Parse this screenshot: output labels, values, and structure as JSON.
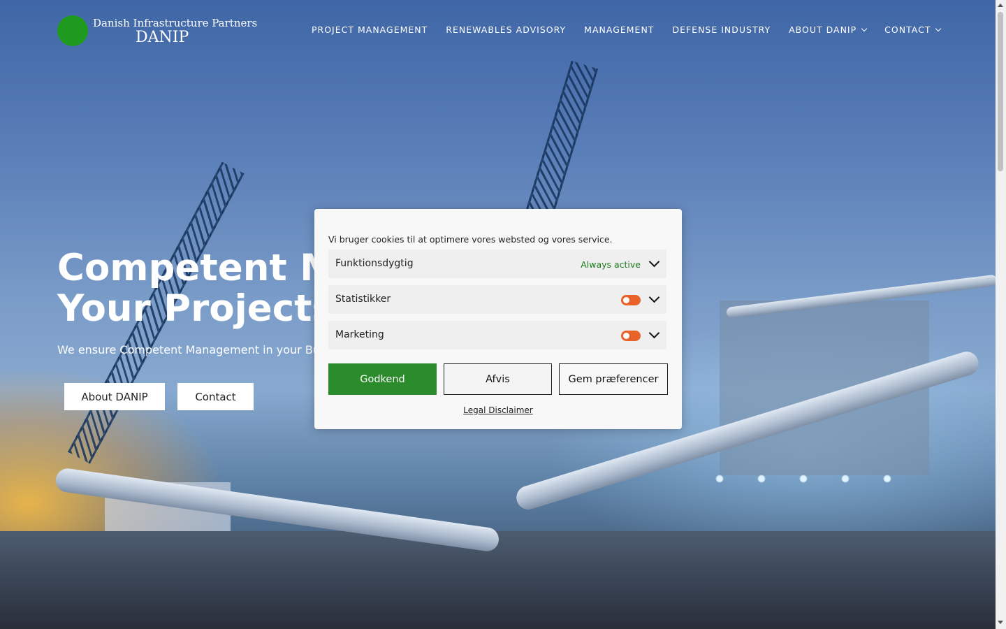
{
  "header": {
    "logo_line1": "Danish Infrastructure Partners",
    "logo_line2": "DANIP",
    "nav": [
      {
        "label": "PROJECT MANAGEMENT"
      },
      {
        "label": "RENEWABLES ADVISORY"
      },
      {
        "label": "MANAGEMENT"
      },
      {
        "label": "DEFENSE INDUSTRY"
      },
      {
        "label": "ABOUT DANIP",
        "dropdown": true
      },
      {
        "label": "CONTACT",
        "dropdown": true
      }
    ]
  },
  "hero": {
    "headline_line1": "Competent Ma",
    "headline_line2": "Your Projects",
    "tagline": "We ensure Competent Management in your Busi",
    "buttons": {
      "about": "About DANIP",
      "contact": "Contact"
    }
  },
  "cookie_banner": {
    "intro": "Vi bruger cookies til at optimere vores websted og vores service.",
    "categories": [
      {
        "label": "Funktionsdygtig",
        "status": "Always active"
      },
      {
        "label": "Statistikker",
        "toggle": "off"
      },
      {
        "label": "Marketing",
        "toggle": "off"
      }
    ],
    "accept_label": "Godkend",
    "deny_label": "Afvis",
    "save_label": "Gem præferencer",
    "legal_link": "Legal Disclaimer"
  },
  "colors": {
    "accent_green": "#2a8b2a",
    "logo_green": "#1f9a1f",
    "toggle_orange": "#e8622a",
    "always_active_green": "#1a7a1a"
  }
}
